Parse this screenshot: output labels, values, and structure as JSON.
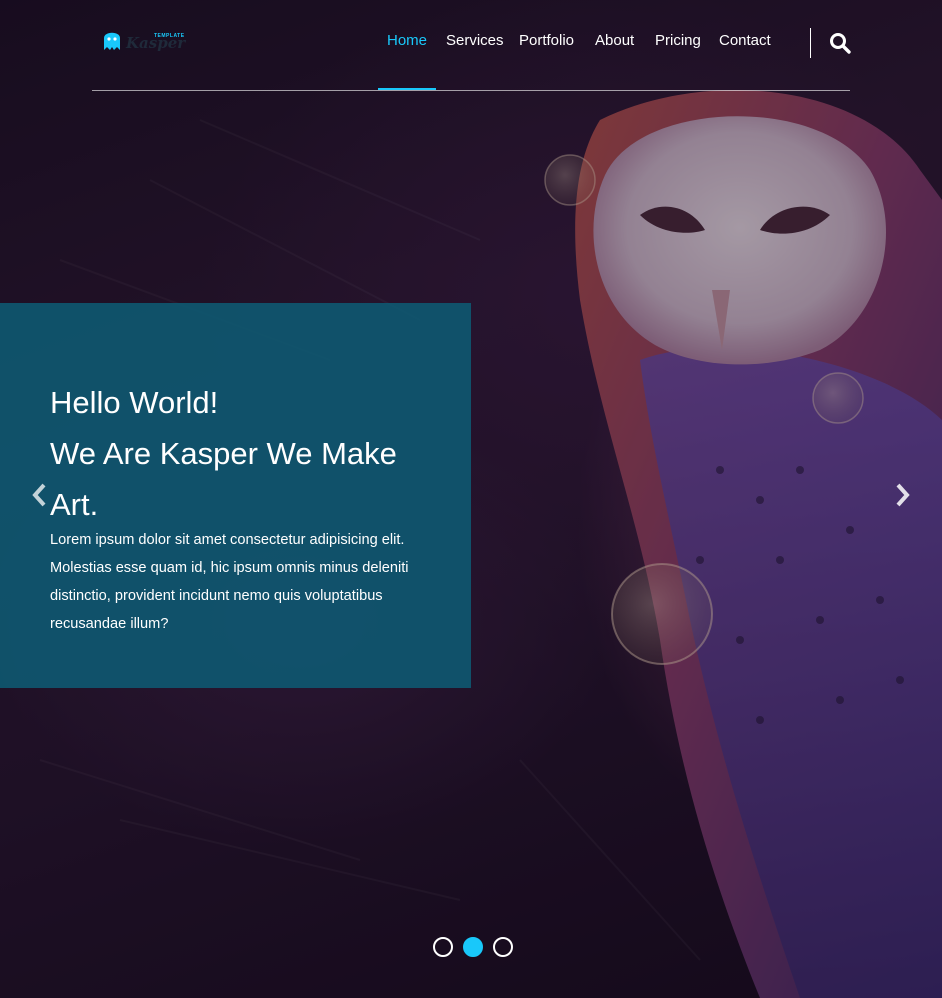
{
  "brand": {
    "small_label": "TEMPLATE",
    "name": "Kasper",
    "accent_color": "#19c8fa"
  },
  "nav": {
    "items": [
      {
        "label": "Home",
        "active": true
      },
      {
        "label": "Services",
        "active": false
      },
      {
        "label": "Portfolio",
        "active": false
      },
      {
        "label": "About",
        "active": false
      },
      {
        "label": "Pricing",
        "active": false
      },
      {
        "label": "Contact",
        "active": false
      }
    ],
    "search_icon": "search-icon"
  },
  "hero": {
    "headline_line1": "Hello World!",
    "headline_line2": "We Are Kasper We Make",
    "headline_line3": "Art.",
    "paragraph": "Lorem ipsum dolor sit amet consectetur adipisicing elit. Molestias esse quam id, hic ipsum omnis minus deleniti distinctio, provident incidunt nemo quis voluptatibus recusandae illum?",
    "panel_color": "#0e5a73",
    "prev_icon": "chevron-left-icon",
    "next_icon": "chevron-right-icon"
  },
  "slider": {
    "dots": 3,
    "active_dot": 2
  }
}
